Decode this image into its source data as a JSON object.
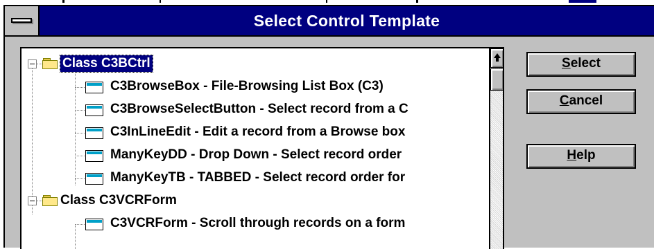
{
  "dialog": {
    "title": "Select Control Template"
  },
  "tree": {
    "groups": [
      {
        "label": "Class C3BCtrl",
        "items": [
          "C3BrowseBox - File-Browsing List Box (C3)",
          "C3BrowseSelectButton - Select record from a C",
          "C3InLineEdit - Edit a record from a Browse box",
          "ManyKeyDD - Drop Down - Select record order",
          "ManyKeyTB - TABBED - Select record order for"
        ]
      },
      {
        "label": "Class C3VCRForm",
        "items": [
          "C3VCRForm - Scroll through records on a form"
        ]
      }
    ]
  },
  "buttons": {
    "select": {
      "mnemonic": "S",
      "rest": "elect"
    },
    "cancel": {
      "mnemonic": "C",
      "rest": "ancel"
    },
    "help": {
      "mnemonic": "H",
      "rest": "elp"
    }
  },
  "colors": {
    "titlebar": "#000080",
    "face": "#c0c0c0",
    "selection": "#000080",
    "folder": "#ffe88a",
    "control_icon": "#00a0c8"
  }
}
